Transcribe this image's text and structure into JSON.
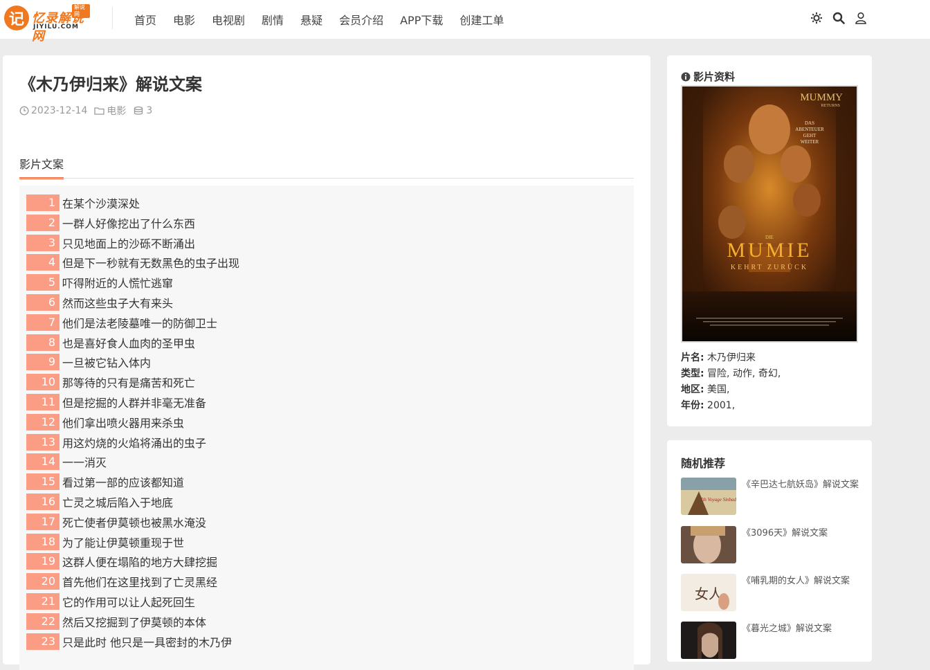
{
  "header": {
    "logo": {
      "mark": "记",
      "name": "忆录解说网",
      "domain": "JIYILU.COM",
      "badge": "解说网"
    },
    "nav": [
      "首页",
      "电影",
      "电视剧",
      "剧情",
      "悬疑",
      "会员介绍",
      "APP下载",
      "创建工单"
    ],
    "tools": [
      "theme-icon",
      "search-icon",
      "user-icon"
    ]
  },
  "article": {
    "title": "《木乃伊归来》解说文案",
    "date": "2023-12-14",
    "category": "电影",
    "views": "3",
    "tab_label": "影片文案",
    "lines": [
      {
        "n": "1",
        "text": "在某个沙漠深处"
      },
      {
        "n": "2",
        "text": "一群人好像挖出了什么东西"
      },
      {
        "n": "3",
        "text": "只见地面上的沙砾不断涌出"
      },
      {
        "n": "4",
        "text": "但是下一秒就有无数黑色的虫子出现"
      },
      {
        "n": "5",
        "text": "吓得附近的人慌忙逃窜"
      },
      {
        "n": "6",
        "text": "然而这些虫子大有来头"
      },
      {
        "n": "7",
        "text": "他们是法老陵墓唯一的防御卫士"
      },
      {
        "n": "8",
        "text": "也是喜好食人血肉的圣甲虫"
      },
      {
        "n": "9",
        "text": "一旦被它钻入体内"
      },
      {
        "n": "10",
        "text": "那等待的只有是痛苦和死亡"
      },
      {
        "n": "11",
        "text": "但是挖掘的人群并非毫无准备"
      },
      {
        "n": "12",
        "text": "他们拿出喷火器用来杀虫"
      },
      {
        "n": "13",
        "text": "用这灼烧的火焰将涌出的虫子"
      },
      {
        "n": "14",
        "text": "一一消灭"
      },
      {
        "n": "15",
        "text": "看过第一部的应该都知道"
      },
      {
        "n": "16",
        "text": "亡灵之城后陷入于地底"
      },
      {
        "n": "17",
        "text": "死亡使者伊莫顿也被黑水淹没"
      },
      {
        "n": "18",
        "text": "为了能让伊莫顿重现于世"
      },
      {
        "n": "19",
        "text": "这群人便在塌陷的地方大肆挖掘"
      },
      {
        "n": "20",
        "text": "首先他们在这里找到了亡灵黑经"
      },
      {
        "n": "21",
        "text": "它的作用可以让人起死回生"
      },
      {
        "n": "22",
        "text": "然后又挖掘到了伊莫顿的本体"
      },
      {
        "n": "23",
        "text": "只是此时 他只是一具密封的木乃伊"
      }
    ]
  },
  "film_info": {
    "heading": "影片资料",
    "poster": {
      "top_title": "MUMMY",
      "top_sub": "RETURNS",
      "tagline": [
        "DAS",
        "ABENTEUER",
        "GEHT",
        "WEITER"
      ],
      "die": "DIE",
      "main_title": "MUMIE",
      "sub_title": "KEHRT ZURÜCK"
    },
    "rows": [
      {
        "label": "片名:",
        "value": " 木乃伊归来"
      },
      {
        "label": "类型:",
        "value": " 冒险, 动作, 奇幻,"
      },
      {
        "label": "地区:",
        "value": " 美国,"
      },
      {
        "label": "年份:",
        "value": " 2001,"
      }
    ]
  },
  "random": {
    "heading": "随机推荐",
    "items": [
      {
        "title": "《辛巴达七航妖岛》解说文案",
        "thumb_text": "7th Voyage Sinbad"
      },
      {
        "title": "《3096天》解说文案"
      },
      {
        "title": "《哺乳期的女人》解说文案",
        "thumb_text": "女人"
      },
      {
        "title": "《暮光之城》解说文案"
      }
    ]
  },
  "colors": {
    "accent": "#f0643c",
    "line_number_bg": "#fb9c85",
    "logo": "#f0781e"
  }
}
